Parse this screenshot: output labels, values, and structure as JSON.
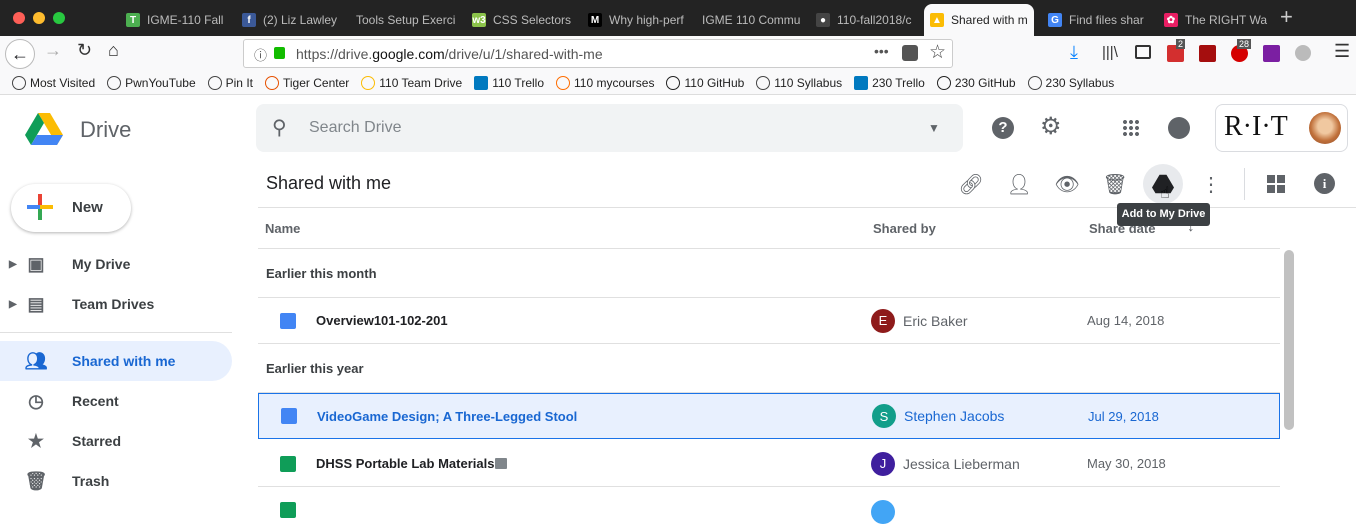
{
  "browser": {
    "tabs": [
      {
        "label": "IGME-110 Fall",
        "color": "#4caf50",
        "glyph": "T"
      },
      {
        "label": "(2) Liz Lawley",
        "color": "#3b5998",
        "glyph": "f"
      },
      {
        "label": "Tools Setup Exerci",
        "color": "",
        "glyph": ""
      },
      {
        "label": "CSS Selectors",
        "color": "#8bc34a",
        "glyph": "w3"
      },
      {
        "label": "Why high-perf",
        "color": "#000000",
        "glyph": "M"
      },
      {
        "label": "IGME 110 Commun",
        "color": "",
        "glyph": ""
      },
      {
        "label": "110-fall2018/c",
        "color": "#444444",
        "glyph": "●"
      },
      {
        "label": "Shared with m",
        "color": "#fbbc04",
        "glyph": "▲"
      },
      {
        "label": "Find files shar",
        "color": "#4285f4",
        "glyph": "G"
      },
      {
        "label": "The RIGHT Wa",
        "color": "#e91e63",
        "glyph": "✿"
      }
    ],
    "active_tab": 7,
    "url_prefix": "https://drive.",
    "url_domain": "google.com",
    "url_path": "/drive/u/1/shared-with-me",
    "badges": {
      "todo": "2",
      "adblock": "28"
    },
    "bookmarks": [
      "Most Visited",
      "PwnYouTube",
      "Pin It",
      "Tiger Center",
      "110 Team Drive",
      "110 Trello",
      "110 mycourses",
      "110 GitHub",
      "110 Syllabus",
      "230 Trello",
      "230 GitHub",
      "230 Syllabus"
    ]
  },
  "drive": {
    "app_name": "Drive",
    "search_placeholder": "Search Drive",
    "account_logo": "R·I·T",
    "new_label": "New",
    "sidebar": [
      {
        "label": "My Drive",
        "icon": "my-drive-icon"
      },
      {
        "label": "Team Drives",
        "icon": "team-drives-icon"
      },
      {
        "label": "Shared with me",
        "icon": "people-icon"
      },
      {
        "label": "Recent",
        "icon": "clock-icon"
      },
      {
        "label": "Starred",
        "icon": "star-icon"
      },
      {
        "label": "Trash",
        "icon": "trash-icon"
      }
    ],
    "page_title": "Shared with me",
    "tooltip": "Add to My Drive",
    "columns": {
      "name": "Name",
      "shared_by": "Shared by",
      "share_date": "Share date"
    },
    "sections": [
      {
        "label": "Earlier this month",
        "files": [
          {
            "name": "Overview101-102-201",
            "type": "doc",
            "owner": "Eric Baker",
            "initial": "E",
            "avatar_color": "#8e1b1b",
            "date": "Aug 14, 2018",
            "selected": false
          }
        ]
      },
      {
        "label": "Earlier this year",
        "files": [
          {
            "name": "VideoGame Design; A Three-Legged Stool",
            "type": "doc",
            "owner": "Stephen Jacobs",
            "initial": "S",
            "avatar_color": "#129e8a",
            "date": "Jul 29, 2018",
            "selected": true
          },
          {
            "name": "DHSS Portable Lab Materials",
            "type": "sheet",
            "owner": "Jessica Lieberman",
            "initial": "J",
            "avatar_color": "#3f1f9e",
            "date": "May 30, 2018",
            "selected": false
          }
        ]
      }
    ],
    "colors": {
      "accent": "#1a73e8",
      "selected_bg": "#e8f0fe"
    }
  }
}
